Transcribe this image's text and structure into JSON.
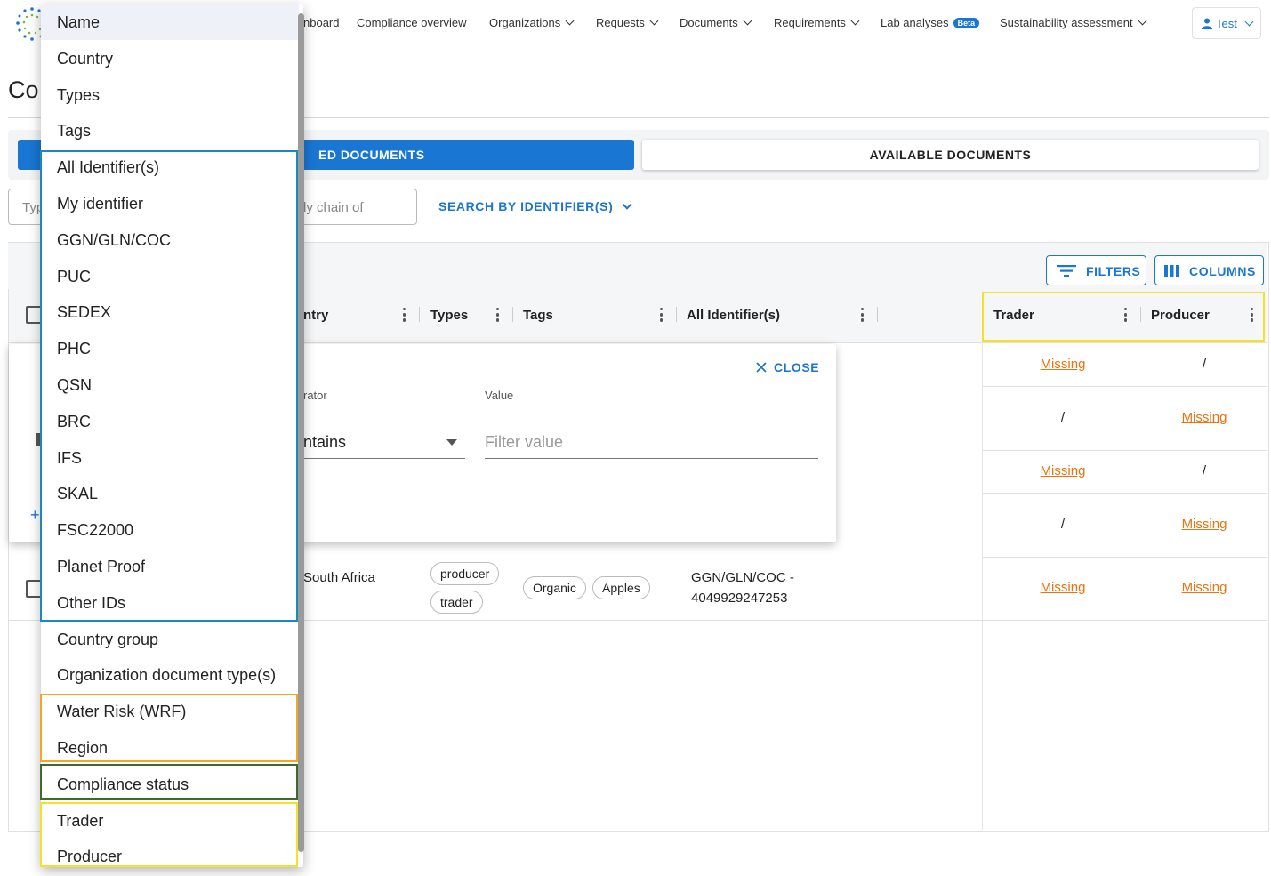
{
  "nav": {
    "items": [
      {
        "label": "nboard",
        "has_chevron": false
      },
      {
        "label": "Compliance overview",
        "has_chevron": false
      },
      {
        "label": "Organizations",
        "has_chevron": true
      },
      {
        "label": "Requests",
        "has_chevron": true
      },
      {
        "label": "Documents",
        "has_chevron": true
      },
      {
        "label": "Requirements",
        "has_chevron": true
      },
      {
        "label": "Lab analyses",
        "has_chevron": false,
        "badge": "Beta"
      },
      {
        "label": "Sustainability assessment",
        "has_chevron": true
      }
    ],
    "user": {
      "label": "Test",
      "icon": "user-icon"
    }
  },
  "page": {
    "title": "Co"
  },
  "tabs": {
    "selected_label": "ED DOCUMENTS",
    "available_label": "AVAILABLE DOCUMENTS"
  },
  "search": {
    "type_placeholder": "Typ",
    "chain_placeholder": "ly chain of",
    "identifier_button": "SEARCH BY IDENTIFIER(S)"
  },
  "toolbar": {
    "filters_label": "FILTERS",
    "columns_label": "COLUMNS"
  },
  "columns": {
    "country": "ntry",
    "types": "Types",
    "tags": "Tags",
    "identifiers": "All Identifier(s)",
    "trader": "Trader",
    "producer": "Producer"
  },
  "rows": [
    {
      "trader": "Missing",
      "producer": "/"
    },
    {
      "trader": "/",
      "producer": "Missing"
    },
    {
      "trader": "Missing",
      "producer": "/"
    },
    {
      "trader": "/",
      "producer": "Missing"
    },
    {
      "country": "South Africa",
      "types": [
        "producer",
        "trader"
      ],
      "tags": [
        "Organic",
        "Apples"
      ],
      "identifier_line1": "GGN/GLN/COC -",
      "identifier_line2": "4049929247253",
      "trader": "Missing",
      "producer": "Missing"
    }
  ],
  "filter_panel": {
    "close_label": "CLOSE",
    "operator_label": "rator",
    "operator_value": "ntains",
    "value_label": "Value",
    "value_placeholder": "Filter value"
  },
  "column_menu": {
    "items": [
      "Name",
      "Country",
      "Types",
      "Tags",
      "All Identifier(s)",
      "My identifier",
      "GGN/GLN/COC",
      "PUC",
      "SEDEX",
      "PHC",
      "QSN",
      "BRC",
      "IFS",
      "SKAL",
      "FSC22000",
      "Planet Proof",
      "Other IDs",
      "Country group",
      "Organization document type(s)",
      "Water Risk (WRF)",
      "Region",
      "Compliance status",
      "Trader",
      "Producer"
    ]
  },
  "highlight_colors": {
    "identifiers": "#1a8ab8",
    "water_region": "#f5a623",
    "compliance": "#3f6b2a",
    "trader_producer": "#f2e32a",
    "accent": "#1976d2",
    "missing": "#e8740f"
  }
}
